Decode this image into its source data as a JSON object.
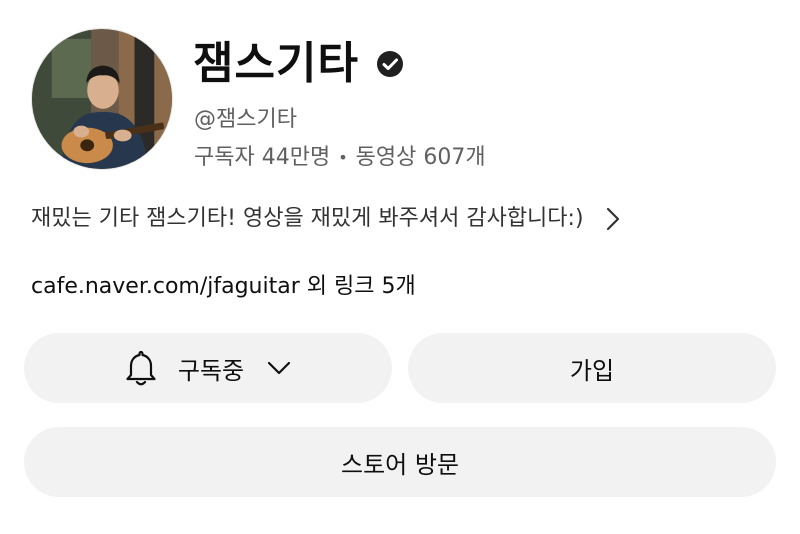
{
  "channel": {
    "name": "잼스기타",
    "handle": "@잼스기타",
    "subscribers": "구독자 44만명",
    "stats_separator": "•",
    "videos": "동영상 607개",
    "avatar_icon": "avatar-guitarist-photo",
    "verified_icon": "verified-check-icon"
  },
  "description": {
    "text": "재밌는 기타 잼스기타! 영상을 재밌게 봐주셔서 감사합니다:)",
    "expand_icon": "chevron-right-icon"
  },
  "links": {
    "url": "cafe.naver.com/jfaguitar",
    "more_text": " 외 링크 5개"
  },
  "actions": {
    "subscribe_label": "구독중",
    "subscribe_icon": "bell-icon",
    "subscribe_dropdown_icon": "chevron-down-icon",
    "join_label": "가입",
    "store_label": "스토어 방문"
  },
  "colors": {
    "button_bg": "#f2f2f2",
    "secondary_text": "#606060",
    "primary_text": "#0f0f0f"
  }
}
